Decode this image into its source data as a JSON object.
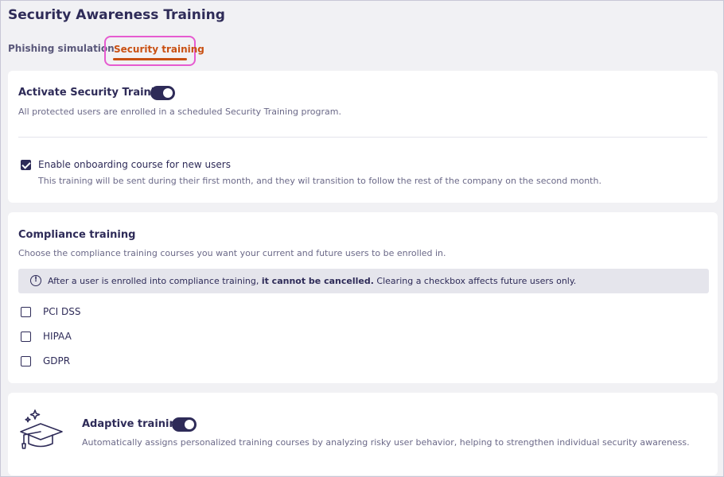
{
  "page_title": "Security Awareness Training",
  "tabs": [
    {
      "label": "Phishing simulation",
      "active": false
    },
    {
      "label": "Security training",
      "active": true
    }
  ],
  "activate": {
    "title": "Activate Security Training",
    "description": "All protected users are enrolled in a scheduled Security Training program.",
    "enabled": true
  },
  "onboarding": {
    "label": "Enable onboarding course for new users",
    "description": "This training will be sent during their first month, and they wil transition to follow the rest of the company on the second month.",
    "checked": true
  },
  "compliance": {
    "title": "Compliance training",
    "description": "Choose the compliance training courses you want your current and future users to be enrolled in.",
    "notice_prefix": "After a user is enrolled into compliance training,",
    "notice_bold": "it cannot be cancelled.",
    "notice_suffix": "Clearing a checkbox affects future users only.",
    "options": [
      {
        "label": "PCI DSS",
        "checked": false
      },
      {
        "label": "HIPAA",
        "checked": false
      },
      {
        "label": "GDPR",
        "checked": false
      }
    ]
  },
  "adaptive": {
    "title": "Adaptive training",
    "description": "Automatically assigns personalized training courses by analyzing risky user behavior, helping to strengthen individual security awareness.",
    "enabled": true
  },
  "icons": {
    "notice": "info-circle-icon",
    "adaptive": "graduation-cap-icon"
  },
  "colors": {
    "primary": "#2e2b58",
    "active_tab": "#c95012",
    "highlight_outline": "#e65bd0"
  }
}
